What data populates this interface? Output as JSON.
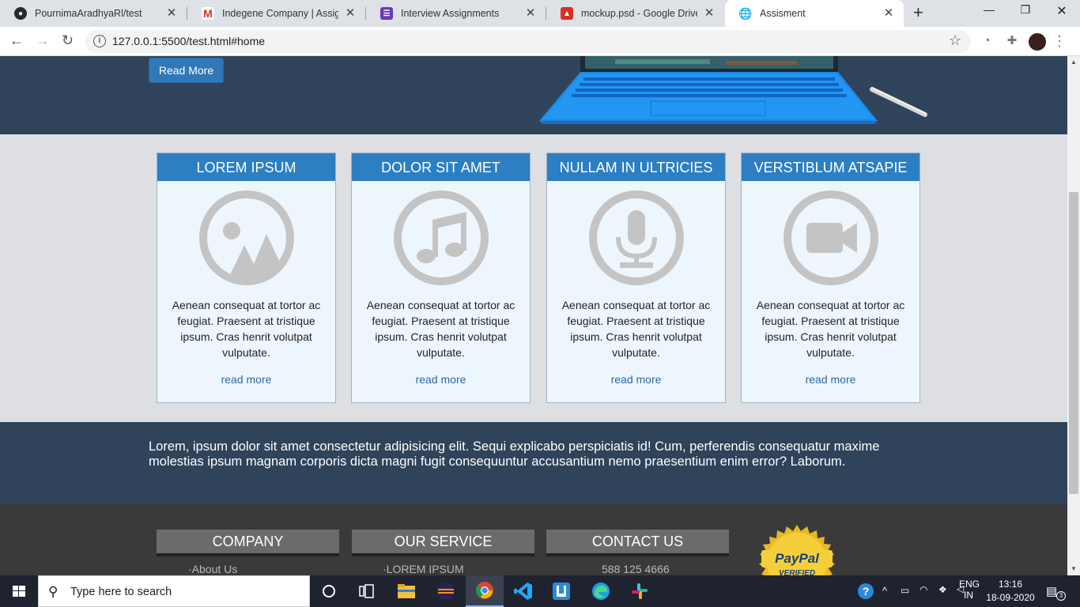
{
  "browser": {
    "tabs": [
      {
        "title": "PournimaAradhyaRl/test",
        "icon": "github-icon"
      },
      {
        "title": "Indegene Company | Assignment",
        "icon": "gmail-icon"
      },
      {
        "title": "Interview Assignments",
        "icon": "forms-icon"
      },
      {
        "title": "mockup.psd - Google Drive",
        "icon": "drive-image-icon"
      },
      {
        "title": "Assisment",
        "icon": "globe-icon",
        "active": true
      }
    ],
    "url": "127.0.0.1:5500/test.html#home"
  },
  "hero": {
    "button_label": "Read More"
  },
  "services": {
    "cards": [
      {
        "title": "LOREM IPSUM",
        "icon": "image-icon",
        "text": "Aenean consequat at tortor ac feugiat. Praesent at tristique ipsum. Cras henrit volutpat vulputate.",
        "link": "read more"
      },
      {
        "title": "DOLOR SIT AMET",
        "icon": "music-note-icon",
        "text": "Aenean consequat at tortor ac feugiat. Praesent at tristique ipsum. Cras henrit volutpat vulputate.",
        "link": "read more"
      },
      {
        "title": "NULLAM IN ULTRICIES",
        "icon": "microphone-icon",
        "text": "Aenean consequat at tortor ac feugiat. Praesent at tristique ipsum. Cras henrit volutpat vulputate.",
        "link": "read more"
      },
      {
        "title": "VERSTIBLUM ATSAPIE",
        "icon": "video-camera-icon",
        "text": "Aenean consequat at tortor ac feugiat. Praesent at tristique ipsum. Cras henrit volutpat vulputate.",
        "link": "read more"
      }
    ]
  },
  "about": {
    "text": "Lorem, ipsum dolor sit amet consectetur adipisicing elit. Sequi explicabo perspiciatis id! Cum, perferendis consequatur maxime molestias ipsum magnam corporis dicta magni fugit consequuntur accusantium nemo praesentium enim error? Laborum."
  },
  "footer": {
    "columns": [
      {
        "heading": "COMPANY",
        "first_item": "About Us"
      },
      {
        "heading": "OUR SERVICE",
        "first_item": "LOREM IPSUM"
      },
      {
        "heading": "CONTACT US",
        "first_item": "588 125 4666"
      }
    ],
    "seal": {
      "line1": "PayPal",
      "line2": "VERIFIED"
    }
  },
  "taskbar": {
    "search_placeholder": "Type here to search",
    "lang_top": "ENG",
    "lang_bottom": "IN",
    "time": "13:16",
    "date": "18-09-2020",
    "notification_count": "3"
  },
  "colors": {
    "hero_bg": "#2f435a",
    "card_header": "#2b7fc2",
    "footer_bg": "#3a3a3a"
  }
}
